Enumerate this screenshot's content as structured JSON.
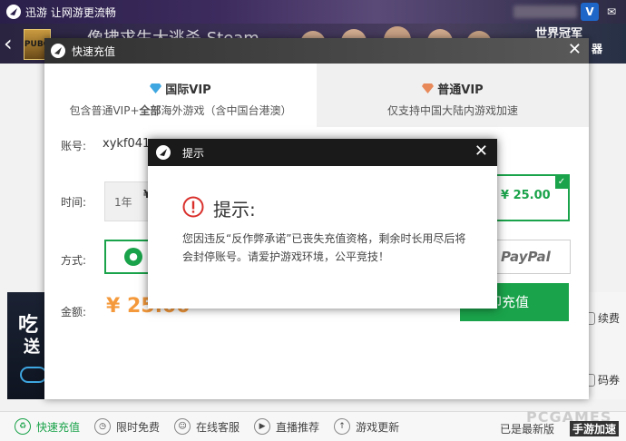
{
  "app": {
    "name": "迅游 让网游更流畅",
    "game_title": "像拂求生大逃杀 Steam",
    "game_thumb": "PUBG",
    "header_line1": "世界冠军",
    "header_line2": "器"
  },
  "recharge": {
    "title": "快速充值",
    "tabs": [
      {
        "label": "国际VIP",
        "desc_pre": "包含普通VIP+",
        "desc_bold": "全部",
        "desc_post": "海外游戏（含中国台港澳）"
      },
      {
        "label": "普通VIP",
        "desc": "仅支持中国大陆内游戏加速"
      }
    ],
    "account_label": "账号:",
    "account_value": "xykf041",
    "time_label": "时间:",
    "period_1y_label": "1年",
    "period_1y_price": "¥",
    "period_selected_price": "¥ 25.00",
    "method_label": "方式:",
    "paypal_label": "PayPal",
    "amount_label": "金额:",
    "amount_value": "¥ 25.00",
    "pay_button": "立即充值"
  },
  "notice": {
    "title": "提示",
    "heading": "提示:",
    "body": "您因违反“反作弊承诺”已丧失充值资格，剩余时长用尽后将会封停账号。请爱护游戏环境，公平竞技！"
  },
  "side": {
    "renew": "续费",
    "code": "码券"
  },
  "left_banner": {
    "line1": "吃",
    "line2": "送"
  },
  "bottom": {
    "items": [
      "快速充值",
      "限时免费",
      "在线客服",
      "直播推荐",
      "游戏更新"
    ],
    "version": "已是最新版",
    "watermark": "PCGAMES",
    "watermark2": "手游加速"
  },
  "colors": {
    "accent_green": "#1aa34a",
    "amount_orange": "#f59a3c",
    "dark_titlebar": "#1a1a1a",
    "warn_red": "#d9302c"
  }
}
